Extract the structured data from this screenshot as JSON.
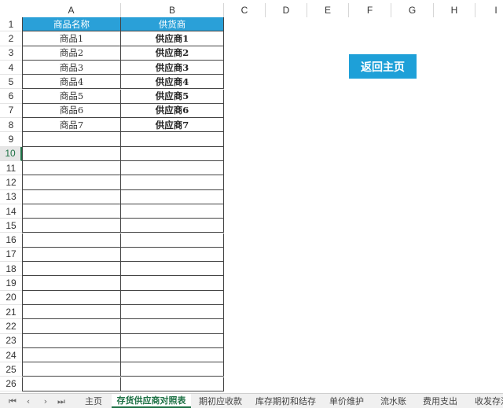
{
  "columns": [
    "A",
    "B",
    "C",
    "D",
    "E",
    "F",
    "G",
    "H",
    "I"
  ],
  "row_numbers": [
    "1",
    "2",
    "3",
    "4",
    "5",
    "6",
    "7",
    "8",
    "9",
    "10",
    "11",
    "12",
    "13",
    "14",
    "15",
    "16",
    "17",
    "18",
    "19",
    "20",
    "21",
    "22",
    "23",
    "24",
    "25",
    "26"
  ],
  "active_row": "10",
  "table": {
    "headers": [
      "商品名称",
      "供货商"
    ],
    "rows": [
      [
        "商品1",
        "供应商1"
      ],
      [
        "商品2",
        "供应商2"
      ],
      [
        "商品3",
        "供应商3"
      ],
      [
        "商品4",
        "供应商4"
      ],
      [
        "商品5",
        "供应商5"
      ],
      [
        "商品6",
        "供应商6"
      ],
      [
        "商品7",
        "供应商7"
      ]
    ]
  },
  "button": {
    "label": "返回主页"
  },
  "sheet_nav": [
    "|<",
    "<",
    ">",
    ">|"
  ],
  "sheet_tabs": [
    "主页",
    "存货供应商对照表",
    "期初应收款",
    "库存期初和结存",
    "单价维护",
    "流水账",
    "费用支出",
    "收发存汇"
  ],
  "active_tab": "存货供应商对照表",
  "colors": {
    "header_fill": "#2aa0d8",
    "button_fill": "#1ea0d8",
    "accent": "#1e7145"
  }
}
